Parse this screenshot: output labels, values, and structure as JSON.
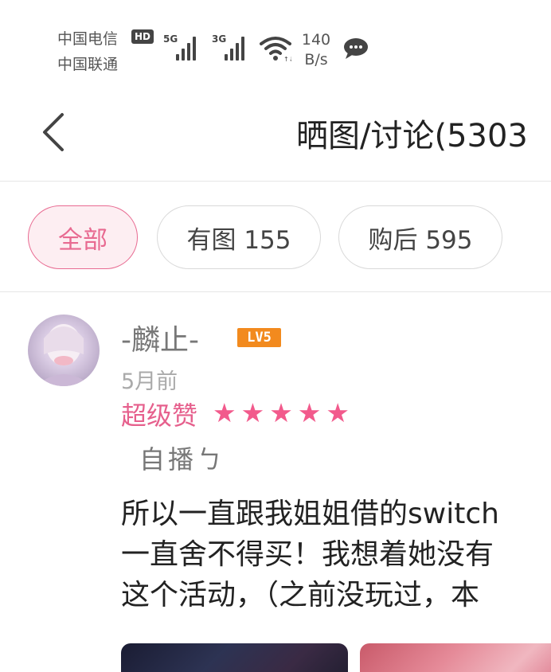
{
  "status_bar": {
    "carrier1": "中国电信",
    "carrier2": "中国联通",
    "hd_badge": "HD",
    "net1": "5G",
    "net2": "3G",
    "speed_value": "140",
    "speed_unit": "B/s"
  },
  "header": {
    "title": "晒图/讨论(5303"
  },
  "tabs": [
    {
      "label": "全部"
    },
    {
      "label": "有图 155"
    },
    {
      "label": "购后 595"
    }
  ],
  "review": {
    "username": "-麟止-",
    "level": "LV5",
    "time": "5月前",
    "rating_label": "超级赞",
    "stars": 5,
    "signature": "自播ㄅ",
    "content_lines": [
      "所以一直跟我姐姐借的switch",
      "一直舍不得买！我想着她没有",
      "这个活动，（之前没玩过，本"
    ]
  },
  "colors": {
    "accent": "#e86a91",
    "star": "#f25a8c",
    "level_badge": "#f28a1e"
  }
}
